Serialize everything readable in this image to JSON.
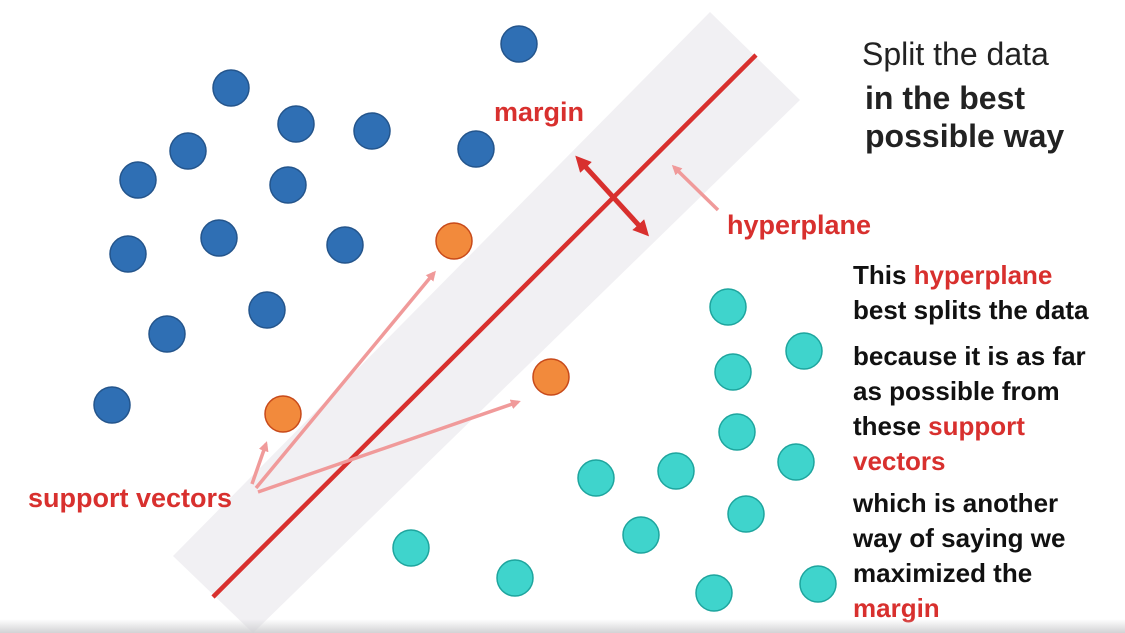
{
  "title": "Split the data",
  "subtitle_line1": "in the best",
  "subtitle_line2": "possible way",
  "labels": {
    "margin": "margin",
    "hyperplane": "hyperplane",
    "support_vectors": "support vectors"
  },
  "explanation": {
    "p1_a": "This ",
    "p1_b": "hyperplane",
    "p1_c": "best splits the data",
    "p2_a": "because it is as far",
    "p2_b": "as possible from",
    "p2_c": "these ",
    "p2_d": "support",
    "p2_e": "vectors",
    "p3_a": "which is another",
    "p3_b": "way of saying we",
    "p3_c": "maximized the",
    "p3_d": "margin"
  },
  "colors": {
    "blue": "#2f6fb4",
    "teal": "#3fd4cc",
    "orange": "#f28a3c",
    "red": "#d8302e",
    "pink_arrow": "#f09a9a",
    "margin_band": "#f1f0f3"
  }
}
